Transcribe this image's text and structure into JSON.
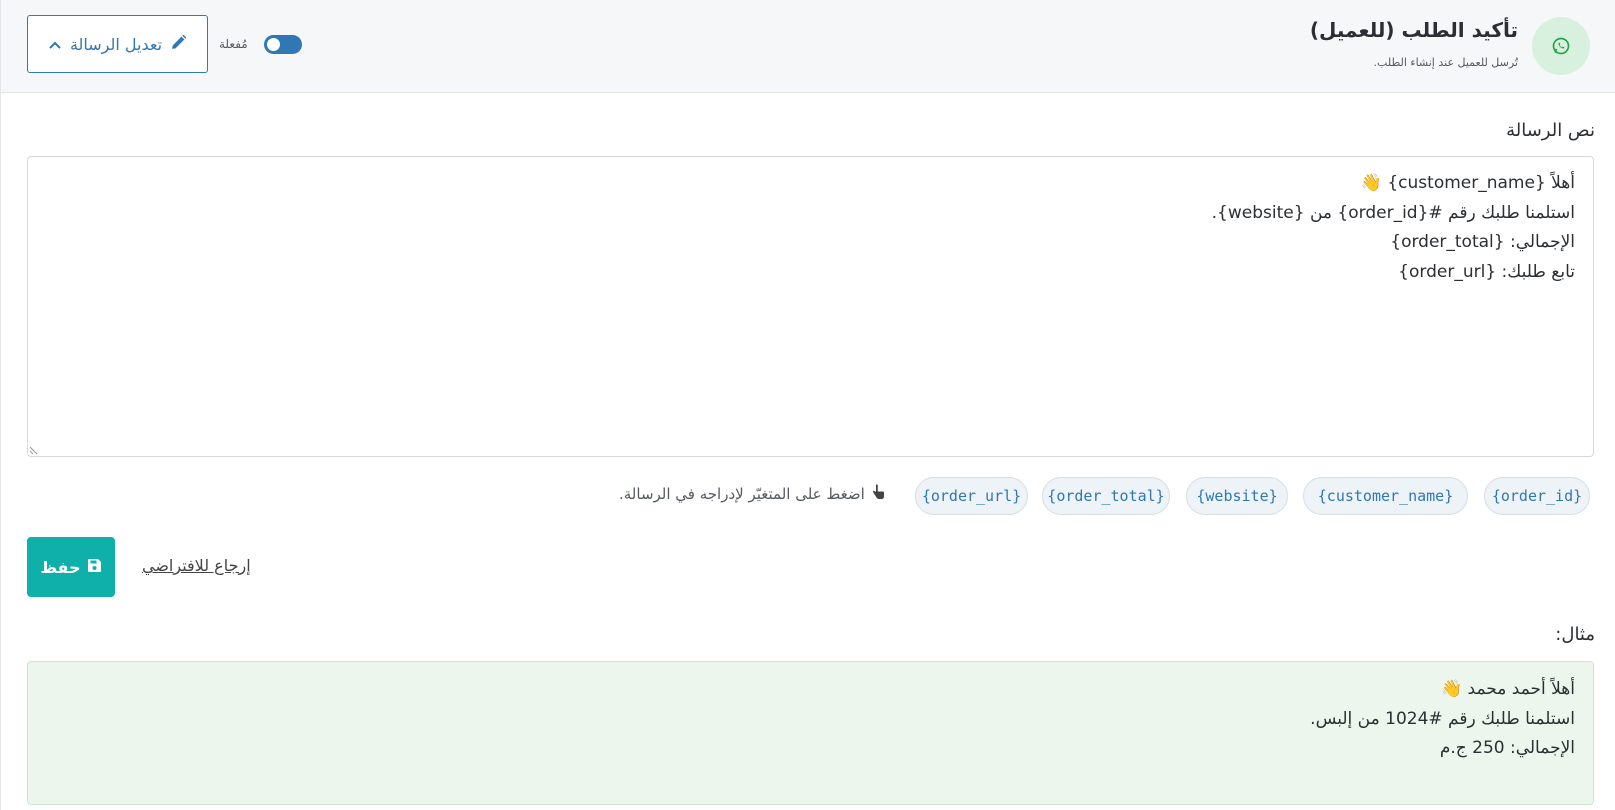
{
  "header": {
    "title": "تأكيد الطلب (للعميل)",
    "subtitle": "تُرسل للعميل عند إنشاء الطلب.",
    "toggle_label": "مُفعلة",
    "toggle_on": true,
    "edit_button_label": "تعديل الرسالة"
  },
  "message": {
    "label": "نص الرسالة",
    "value": "أهلاً {customer_name} 👋\nاستلمنا طلبك رقم #{order_id} من {website}.\nالإجمالي: {order_total}\nتابع طلبك: {order_url}"
  },
  "variables": {
    "chips": [
      "{order_id}",
      "{customer_name}",
      "{website}",
      "{order_total}",
      "{order_url}"
    ],
    "hint": "اضغط على المتغيّر لإدراجه في الرسالة."
  },
  "actions": {
    "save_label": "حفظ",
    "reset_label": "إرجاع للافتراضي"
  },
  "example": {
    "label": "مثال:",
    "text": "أهلاً أحمد محمد 👋\nاستلمنا طلبك رقم #1024 من إلبس.\nالإجمالي: 250 ج.م"
  },
  "colors": {
    "primary": "#2f77b5",
    "save": "#0fb0a9",
    "whatsapp": "#25a244",
    "example_bg": "#ecf6ec"
  }
}
